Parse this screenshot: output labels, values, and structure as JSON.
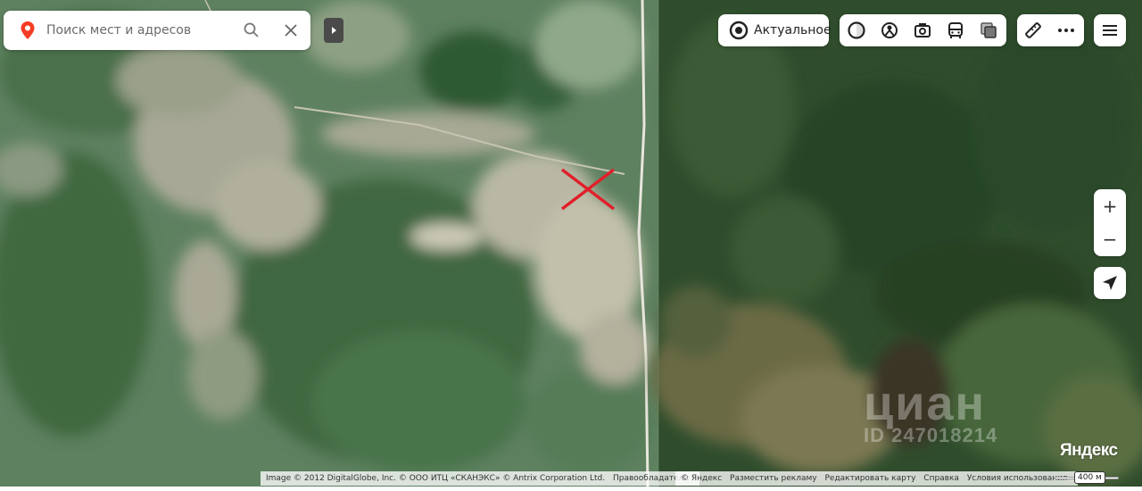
{
  "search": {
    "placeholder": "Поиск мест и адресов"
  },
  "layers": {
    "label": "Актуальное"
  },
  "toolbar": {
    "icons": [
      "traffic-icon",
      "panorama-icon",
      "photo-icon",
      "transport-icon",
      "layers-icon"
    ],
    "extra_icons": [
      "ruler-icon",
      "more-icon"
    ],
    "menu_icon": "menu-icon"
  },
  "zoom": {
    "in_label": "+",
    "out_label": "−"
  },
  "attribution_left": {
    "copyright": "Image © 2012 DigitalGlobe, Inc. © ООО ИТЦ «СКАНЭКС» © Antrix Corporation Ltd.",
    "rights_link": "Правообладатели"
  },
  "attribution_right": {
    "copyright": "© Яндекс",
    "ads_link": "Разместить рекламу",
    "edit_link": "Редактировать карту",
    "help_link": "Справка",
    "terms_link": "Условия использования"
  },
  "brand": "Яндекс",
  "scale_label": "400 м",
  "watermark": {
    "logo": "циан",
    "id": "ID 247018214"
  },
  "colors": {
    "accent_pin": "#f43d24",
    "marker_cross": "#e0202a"
  }
}
